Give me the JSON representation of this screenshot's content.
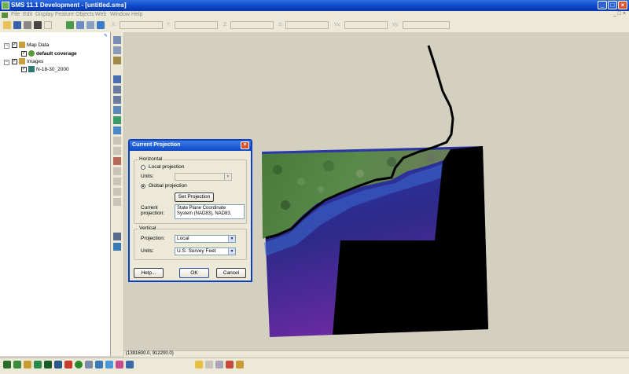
{
  "window": {
    "title": "SMS 11.1 Development - [untitled.sms]"
  },
  "menu": [
    "File",
    "Edit",
    "Display",
    "Feature Objects",
    "Web",
    "Window",
    "Help"
  ],
  "coord_labels": {
    "x": "X:",
    "y": "Y:",
    "z": "Z:",
    "s": "S:",
    "vx": "Vx:",
    "vy": "Vy:"
  },
  "tree": {
    "map_data": "Map Data",
    "default_coverage": "default coverage",
    "images": "Images",
    "image_item": "N-18-30_2000"
  },
  "dialog": {
    "title": "Current Projection",
    "horizontal_group": "Horizontal",
    "local_projection": "Local projection",
    "units_label": "Units:",
    "global_projection": "Global projection",
    "set_projection": "Set Projection",
    "current_projection_label1": "Current",
    "current_projection_label2": "projection:",
    "current_projection_value": "State Plane Coordinate System (NAD83), NAD83,",
    "vertical_group": "Vertical",
    "projection_label": "Projection:",
    "projection_value": "Local",
    "vunits_label": "Units:",
    "vunits_value": "U.S. Survey Feet",
    "help": "Help...",
    "ok": "OK",
    "cancel": "Cancel"
  },
  "status": {
    "coords": "(1391600.0, 912200.0)"
  },
  "colors": {
    "titlebar": "#0a46c8",
    "dialog_border": "#0a3fc0",
    "close": "#d9532f"
  }
}
